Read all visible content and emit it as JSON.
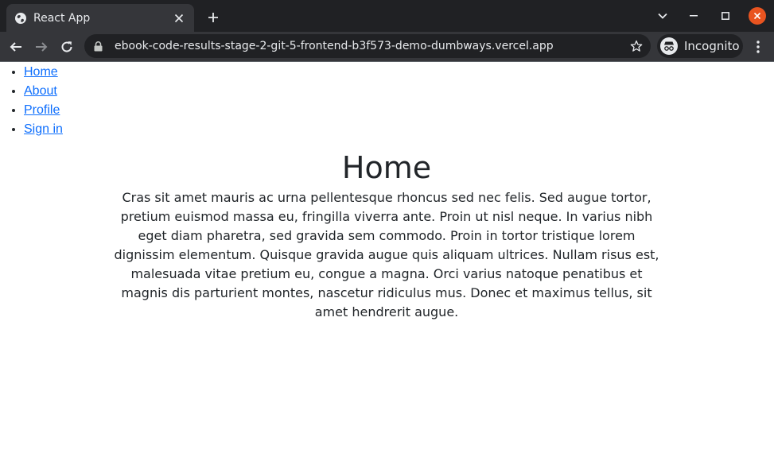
{
  "browser": {
    "tab_title": "React App",
    "url": "ebook-code-results-stage-2-git-5-frontend-b3f573-demo-dumbways.vercel.app",
    "incognito_label": "Incognito",
    "icons": {
      "favicon": "globe-icon",
      "tab_close": "close-icon",
      "new_tab": "plus-icon",
      "tab_search": "chevron-down-icon",
      "minimize": "minimize-icon",
      "maximize": "maximize-icon",
      "close_window": "close-window-icon",
      "back": "arrow-left-icon",
      "forward": "arrow-right-icon",
      "reload": "reload-icon",
      "lock": "lock-icon",
      "bookmark": "star-icon",
      "incognito": "incognito-icon",
      "menu": "kebab-menu-icon"
    },
    "colors": {
      "tabbar_bg": "#202124",
      "toolbar_bg": "#35363a",
      "close_window_bg": "#e95420"
    }
  },
  "page": {
    "nav": [
      {
        "label": "Home"
      },
      {
        "label": "About"
      },
      {
        "label": "Profile"
      },
      {
        "label": "Sign in"
      }
    ],
    "heading": "Home",
    "paragraph": "Cras sit amet mauris ac urna pellentesque rhoncus sed nec felis. Sed augue tortor, pretium euismod massa eu, fringilla viverra ante. Proin ut nisl neque. In varius nibh eget diam pharetra, sed gravida sem commodo. Proin in tortor tristique lorem dignissim elementum. Quisque gravida augue quis aliquam ultrices. Nullam risus est, malesuada vitae pretium eu, congue a magna. Orci varius natoque penatibus et magnis dis parturient montes, nascetur ridiculus mus. Donec et maximus tellus, sit amet hendrerit augue.",
    "colors": {
      "link": "#0d6efd",
      "text": "#212529"
    }
  }
}
